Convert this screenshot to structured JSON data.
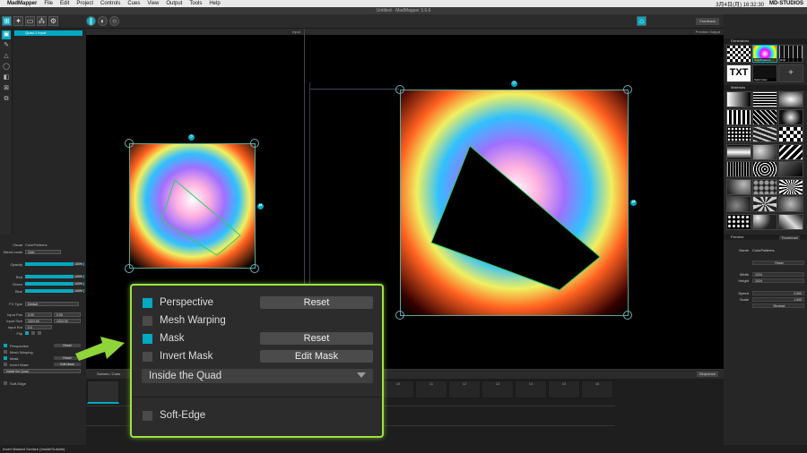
{
  "menubar": {
    "app": "MadMapper",
    "items": [
      "File",
      "Edit",
      "Project",
      "Controls",
      "Cues",
      "View",
      "Output",
      "Tools",
      "Help"
    ],
    "clock": "3月4日(月)  16:32:30",
    "account": "MD-STUDIOS"
  },
  "window_title": "Untitled - MadMapper 3.6.6",
  "toolbar": {
    "feedback_label": "Feedback"
  },
  "left": {
    "surface_name": "Quad-1 input",
    "visual_label": "Visual",
    "visual_value": "ColorPatterns",
    "blend_label": "Blend mode",
    "blend_value": "Over",
    "opacity_label": "Opacity",
    "opacity_value": "100%",
    "red_label": "Red",
    "red_value": "100%",
    "green_label": "Green",
    "green_value": "100%",
    "blue_label": "Blue",
    "blue_value": "100%",
    "fx_label": "FX Type",
    "fx_value": "Default",
    "input_pos_label": "Input Pos",
    "input_pos_x": "0.00",
    "input_pos_y": "0.00",
    "input_size_label": "Input Size",
    "input_size_x": "1024.00",
    "input_size_y": "1024.00",
    "input_rot_label": "Input Rot",
    "input_rot_value": "0.0",
    "flip_label": "Flip",
    "perspective_label": "Perspective",
    "mesh_label": "Mesh Warping",
    "mask_label": "Mask",
    "invert_label": "Invert Mask",
    "reset_label": "Reset",
    "edit_mask_label": "Edit Mask",
    "inside_label": "Inside the Quad",
    "soft_edge_label": "Soft-Edge"
  },
  "viewers": {
    "input_label": "Input",
    "output_label": "Preview Output"
  },
  "timeline": {
    "tab_label": "Scenes / Cues",
    "columns": [
      "10",
      "11",
      "12",
      "13",
      "14",
      "15",
      "16"
    ],
    "sequence_label": "Sequence"
  },
  "right": {
    "generators_label": "Generators",
    "materials_label": "Materials",
    "preview_label": "Preview",
    "preview_mode": "Thumbnail",
    "name_label": "Name",
    "name_value": "ColorPatterns",
    "reset_label": "Reset",
    "width_label": "Width",
    "width_value": "1024",
    "height_label": "Height",
    "height_value": "1024",
    "speed_label": "Speed",
    "speed_value": "0.500",
    "scale_label": "Scale",
    "scale_value": "1.000",
    "reverse_label": "Reverse",
    "thumbs": [
      {
        "label": "",
        "kind": "checker"
      },
      {
        "label": "ColorPatterns",
        "kind": "color"
      },
      {
        "label": "Grid",
        "kind": "grid"
      },
      {
        "label": "Solid Color",
        "kind": "txt"
      },
      {
        "label": "",
        "kind": "plus"
      }
    ],
    "materials": [
      "Gradient",
      "Line",
      "Cube",
      "Bar",
      "Line Patterns",
      "Sphere",
      "Dots",
      "Wave",
      "Chess",
      "Sine",
      "Random",
      "Stripes",
      "Vert Pulse",
      "Ripple",
      "Pattern",
      "Abstract",
      "Cells",
      "Rays",
      "Noise",
      "Kaleido",
      "Cloud",
      "Halftone",
      "Voronoi",
      "Mirror"
    ]
  },
  "callout": {
    "perspective": "Perspective",
    "mesh": "Mesh Warping",
    "mask": "Mask",
    "invert": "Invert Mask",
    "reset1": "Reset",
    "reset2": "Reset",
    "edit_mask": "Edit Mask",
    "inside": "Inside the Quad",
    "soft_edge": "Soft-Edge"
  },
  "status": "Invert Masked Surface (Inside/Outside)",
  "colors": {
    "accent": "#00a8c0",
    "highlight": "#9be23f"
  }
}
